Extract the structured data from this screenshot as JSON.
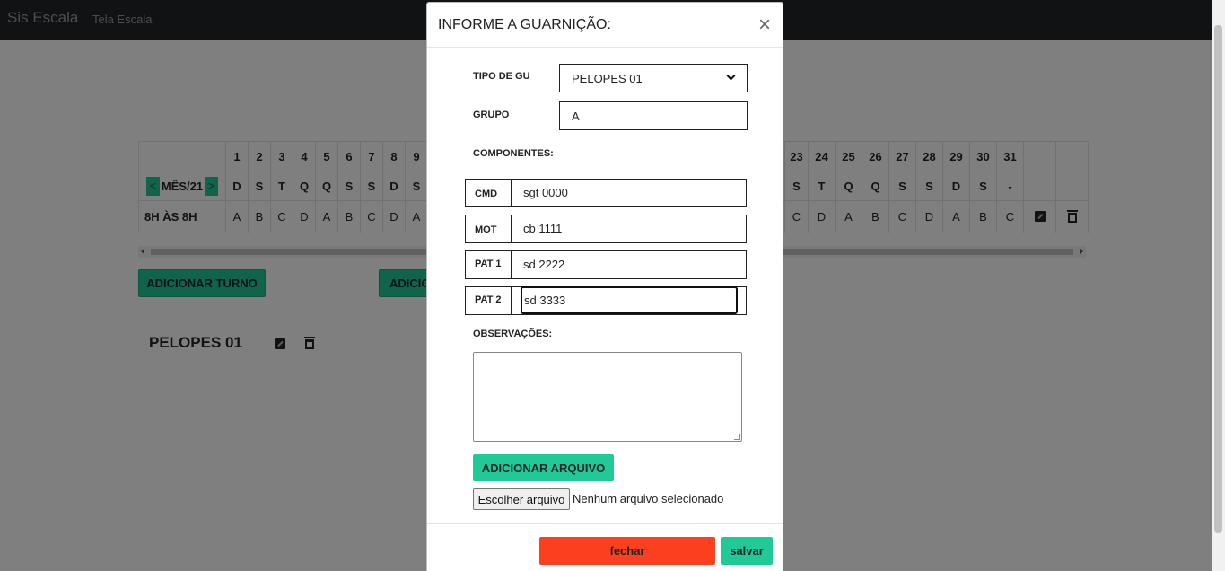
{
  "navbar": {
    "brand": "Sis Escala",
    "link": "Tela Escala"
  },
  "table": {
    "month_label": "MÊS/21",
    "prev": "<",
    "next": ">",
    "days_left": [
      "1",
      "2",
      "3",
      "4",
      "5",
      "6",
      "7",
      "8",
      "9"
    ],
    "weekdays_left": [
      "D",
      "S",
      "T",
      "Q",
      "Q",
      "S",
      "S",
      "D",
      "S"
    ],
    "days_right": [
      "23",
      "24",
      "25",
      "26",
      "27",
      "28",
      "29",
      "30",
      "31"
    ],
    "weekdays_right": [
      "S",
      "T",
      "Q",
      "Q",
      "S",
      "S",
      "D",
      "S",
      "-"
    ],
    "shift_label": "8H ÀS 8H",
    "shift_left": [
      "A",
      "B",
      "C",
      "D",
      "A",
      "B",
      "C",
      "D",
      "A"
    ],
    "shift_right": [
      "C",
      "D",
      "A",
      "B",
      "C",
      "D",
      "A",
      "B",
      "C"
    ]
  },
  "buttons": {
    "add_turno": "ADICIONAR TURNO",
    "add_second": "ADICIO"
  },
  "guarnicao_title": "PELOPES 01",
  "modal": {
    "title": "INFORME A GUARNIÇÃO:",
    "close": "×",
    "tipo_label": "TIPO DE GU",
    "tipo_value": "PELOPES 01",
    "grupo_label": "GRUPO",
    "grupo_value": "A",
    "componentes_label": "COMPONENTES:",
    "componentes": [
      {
        "label": "CMD",
        "value": "sgt 0000"
      },
      {
        "label": "MOT",
        "value": "cb 1111"
      },
      {
        "label": "PAT 1",
        "value": "sd 2222"
      },
      {
        "label": "PAT 2",
        "value": "sd 3333"
      }
    ],
    "obs_label": "OBSERVAÇÕES:",
    "add_file": "ADICIONAR ARQUIVO",
    "choose_file": "Escolher arquivo",
    "file_status": "Nenhum arquivo selecionado",
    "fechar": "fechar",
    "salvar": "salvar"
  }
}
